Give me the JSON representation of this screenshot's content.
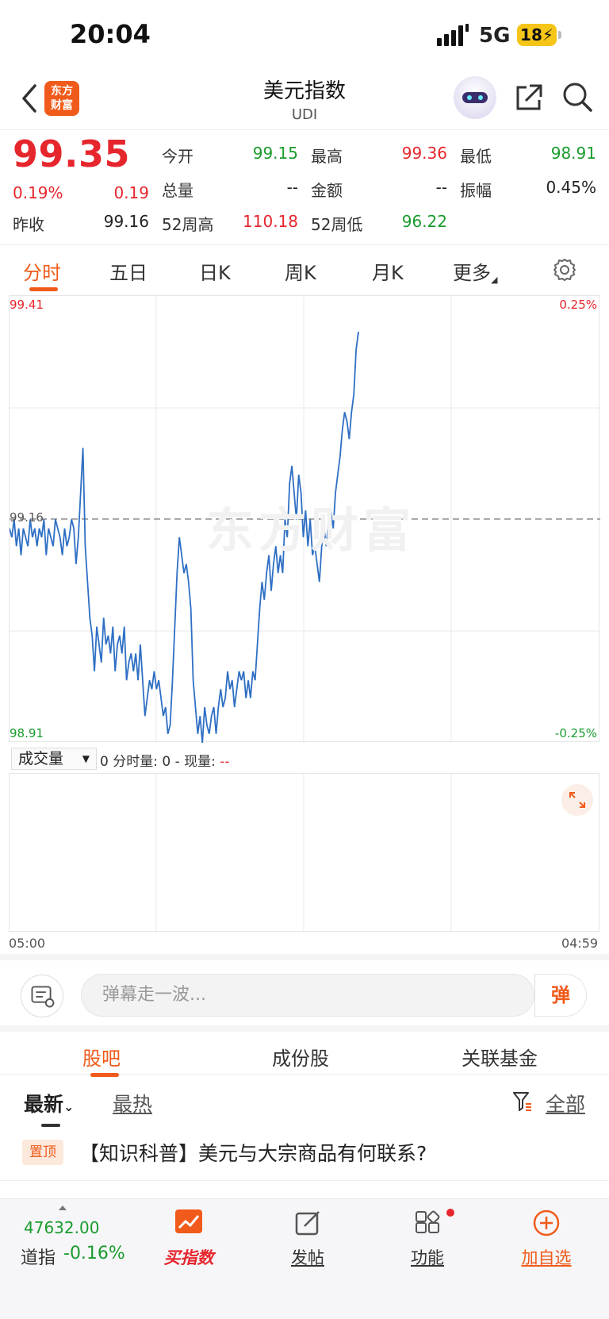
{
  "status_bar": {
    "time": "20:04",
    "network": "5G",
    "battery": "18"
  },
  "nav": {
    "logo_text": "东方\n财富",
    "title": "美元指数",
    "subtitle": "UDI"
  },
  "quote": {
    "price": "99.35",
    "change_pct": "0.19%",
    "change": "0.19",
    "prev_close_label": "昨收",
    "prev_close": "99.16",
    "open_label": "今开",
    "open": "99.15",
    "high_label": "最高",
    "high": "99.36",
    "low_label": "最低",
    "low": "98.91",
    "volume_label": "总量",
    "volume": "--",
    "amount_label": "金额",
    "amount": "--",
    "amplitude_label": "振幅",
    "amplitude": "0.45%",
    "wk52_high_label": "52周高",
    "wk52_high": "110.18",
    "wk52_low_label": "52周低",
    "wk52_low": "96.22"
  },
  "chart_tabs": [
    "分时",
    "五日",
    "日K",
    "周K",
    "月K",
    "更多"
  ],
  "chart": {
    "y_top": "99.41",
    "y_mid": "99.16",
    "y_bottom": "98.91",
    "pct_top": "0.25%",
    "pct_bottom": "-0.25%",
    "watermark": "东方财富",
    "time_start": "05:00",
    "time_end": "04:59"
  },
  "chart_data": {
    "type": "line",
    "title": "",
    "x_start": "05:00",
    "x_end": "04:59",
    "ylim": [
      98.91,
      99.41
    ],
    "reference_line": 99.16,
    "series": [
      {
        "values": [
          99.15,
          99.14,
          99.16,
          99.13,
          99.15,
          99.12,
          99.15,
          99.14,
          99.13,
          99.16,
          99.14,
          99.15,
          99.13,
          99.15,
          99.14,
          99.16,
          99.12,
          99.15,
          99.14,
          99.13,
          99.16,
          99.15,
          99.14,
          99.12,
          99.15,
          99.13,
          99.14,
          99.16,
          99.15,
          99.11,
          99.14,
          99.19,
          99.24,
          99.13,
          99.09,
          99.05,
          99.03,
          98.99,
          99.04,
          99.02,
          99.0,
          99.05,
          99.02,
          99.03,
          99.01,
          99.04,
          98.99,
          99.02,
          99.03,
          99.01,
          99.04,
          98.98,
          99.0,
          99.01,
          98.99,
          99.01,
          98.98,
          99.02,
          98.98,
          98.94,
          98.96,
          98.98,
          98.97,
          98.99,
          98.97,
          98.98,
          98.96,
          98.94,
          98.95,
          98.92,
          98.93,
          98.98,
          99.04,
          99.1,
          99.14,
          99.12,
          99.1,
          99.11,
          99.09,
          99.06,
          98.98,
          98.95,
          98.92,
          98.94,
          98.91,
          98.95,
          98.93,
          98.92,
          98.94,
          98.95,
          98.92,
          98.95,
          98.97,
          98.95,
          98.96,
          98.99,
          98.97,
          98.98,
          98.95,
          98.97,
          98.99,
          98.98,
          98.99,
          98.96,
          98.98,
          98.96,
          98.99,
          98.98,
          99.02,
          99.06,
          99.09,
          99.07,
          99.1,
          99.12,
          99.08,
          99.11,
          99.13,
          99.1,
          99.12,
          99.1,
          99.16,
          99.14,
          99.2,
          99.22,
          99.19,
          99.16,
          99.21,
          99.19,
          99.14,
          99.17,
          99.13,
          99.16,
          99.12,
          99.13,
          99.11,
          99.09,
          99.13,
          99.15,
          99.13,
          99.16,
          99.17,
          99.15,
          99.19,
          99.21,
          99.23,
          99.26,
          99.28,
          99.27,
          99.25,
          99.28,
          99.3,
          99.35,
          99.37
        ]
      }
    ]
  },
  "volume": {
    "select_label": "成交量",
    "info": "0 分时量: 0 - 现量: ",
    "current": "--"
  },
  "danmu": {
    "placeholder": "弹幕走一波...",
    "button": "弹"
  },
  "guba_tabs": [
    "股吧",
    "成份股",
    "关联基金"
  ],
  "filter": {
    "latest": "最新",
    "hot": "最热",
    "all": "全部"
  },
  "post": {
    "badge": "置顶",
    "title": "【知识科普】美元与大宗商品有何联系?"
  },
  "bottom": {
    "dji_value": "47632.00",
    "dji_name": "道指",
    "dji_pct": "-0.16%",
    "buy_index": "买指数",
    "post": "发帖",
    "functions": "功能",
    "add_watch": "加自选"
  },
  "colors": {
    "accent": "#f05a1a",
    "up": "#e6262d",
    "down": "#1a9b2e",
    "line": "#2e6fc4"
  }
}
